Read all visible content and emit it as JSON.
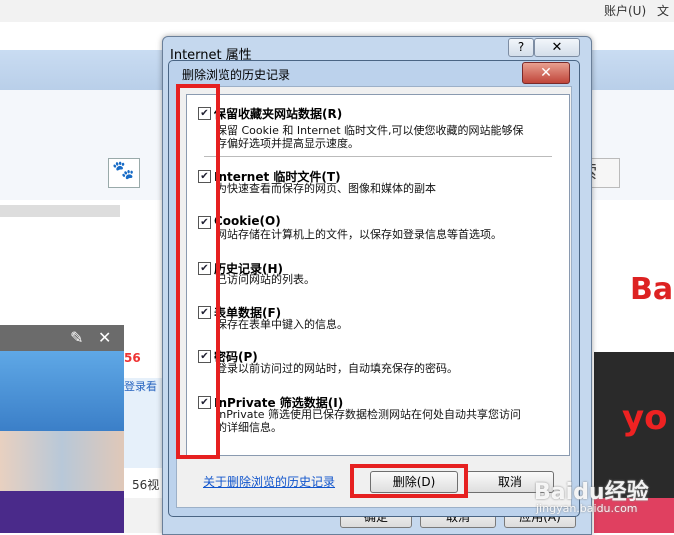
{
  "browser": {
    "account_link": "账户(U)",
    "file_link": "文",
    "search_btn_partial": "索",
    "video_56_badge": "56",
    "login_text": "登录看",
    "video_56_label": "56视",
    "logo_partial": "Ba",
    "right_logo_partial": "yo"
  },
  "outer_dialog": {
    "title": "Internet 属性",
    "help": "?",
    "close": "✕",
    "ok": "确定",
    "cancel": "取消",
    "apply": "应用(A)"
  },
  "delete_dialog": {
    "title": "删除浏览的历史记录",
    "close": "✕",
    "items": [
      {
        "checked": true,
        "title": "保留收藏夹网站数据(R)",
        "desc": [
          "保留 Cookie 和 Internet 临时文件,可以使您收藏的网站能够保",
          "存偏好选项并提高显示速度。"
        ]
      },
      {
        "checked": true,
        "title": "Internet 临时文件(T)",
        "desc": [
          "为快速查看而保存的网页、图像和媒体的副本"
        ]
      },
      {
        "checked": true,
        "title": "Cookie(O)",
        "desc": [
          "网站存储在计算机上的文件，以保存如登录信息等首选项。"
        ]
      },
      {
        "checked": true,
        "title": "历史记录(H)",
        "desc": [
          "已访问网站的列表。"
        ]
      },
      {
        "checked": true,
        "title": "表单数据(F)",
        "desc": [
          "保存在表单中键入的信息。"
        ]
      },
      {
        "checked": true,
        "title": "密码(P)",
        "desc": [
          "登录以前访问过的网站时，自动填充保存的密码。"
        ]
      },
      {
        "checked": true,
        "title": "InPrivate 筛选数据(I)",
        "desc": [
          "InPrivate 筛选使用已保存数据检测网站在何处自动共享您访问",
          "的详细信息。"
        ]
      }
    ],
    "about_link": "关于删除浏览的历史记录",
    "delete_button": "删除(D)",
    "cancel_button": "取消"
  },
  "watermark": {
    "brand": "Baidu经验",
    "url": "jingyan.baidu.com"
  },
  "colors": {
    "highlight": "#e62020",
    "dialog_frame": "#bcd2ec",
    "link": "#1155cc"
  }
}
